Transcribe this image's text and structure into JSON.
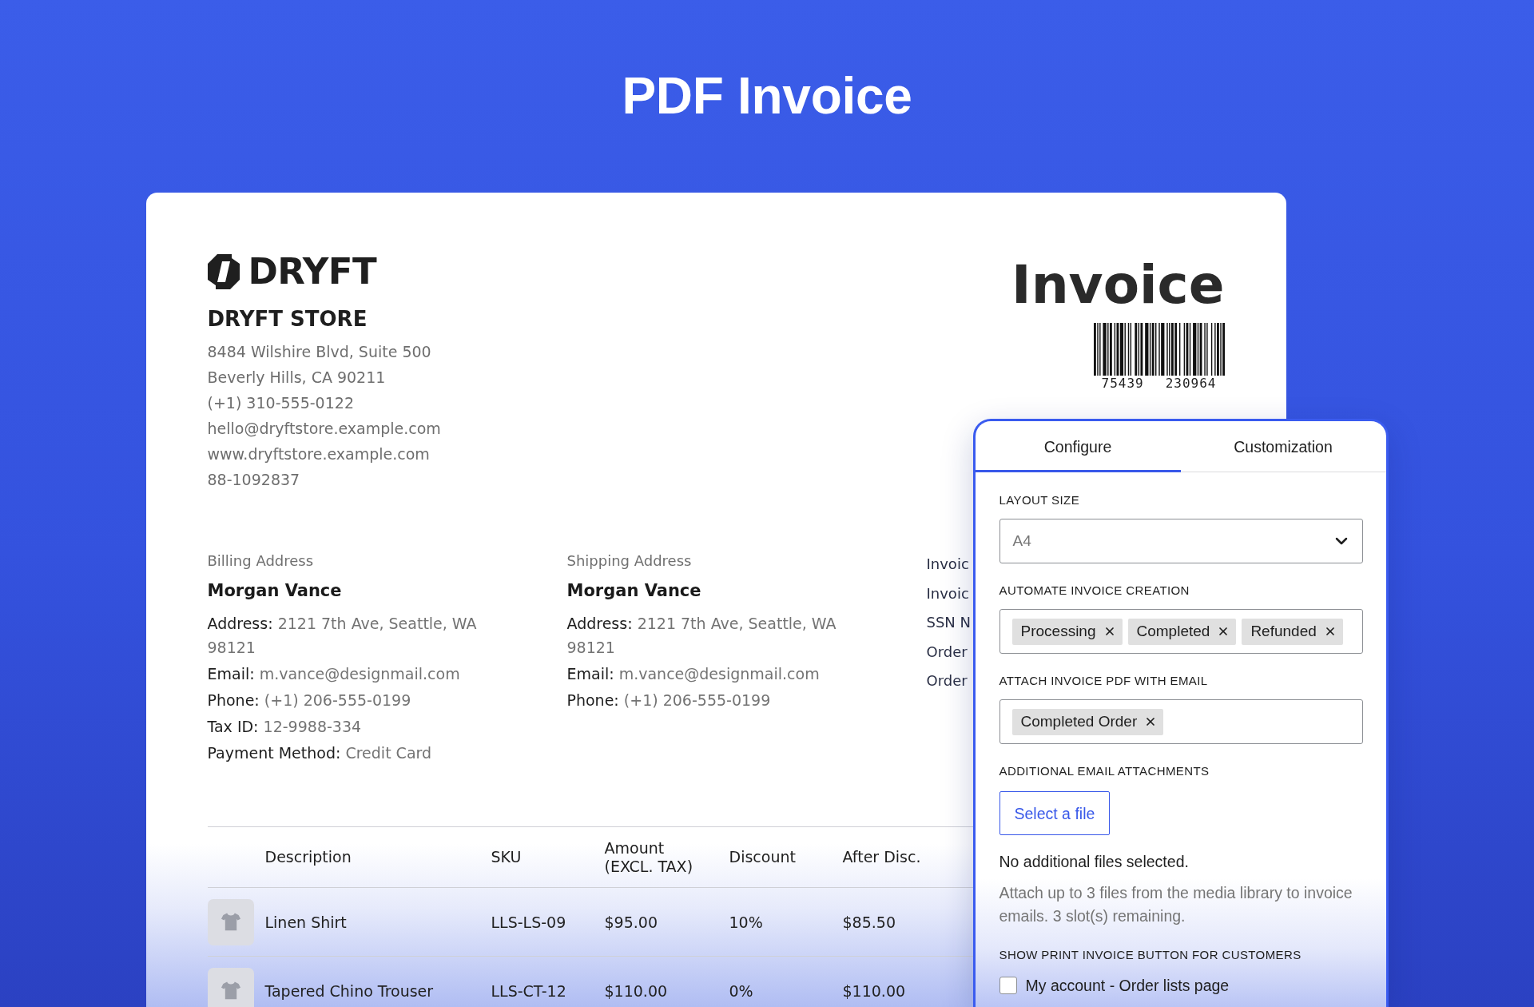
{
  "page_title": "PDF Invoice",
  "invoice": {
    "brand": "DRYFT",
    "store_name": "DRYFT STORE",
    "store_details": [
      "8484 Wilshire Blvd, Suite 500",
      "Beverly Hills, CA 90211",
      "(+1) 310-555-0122",
      "hello@dryftstore.example.com",
      "www.dryftstore.example.com",
      "88-1092837"
    ],
    "title": "Invoice",
    "barcode_digits": [
      "75439",
      "230964"
    ],
    "addresses": [
      {
        "heading": "Billing Address",
        "name": "Morgan Vance",
        "fields": [
          {
            "label": "Address:",
            "value": "2121 7th Ave, Seattle, WA 98121"
          },
          {
            "label": "Email:",
            "value": "m.vance@designmail.com"
          },
          {
            "label": "Phone:",
            "value": "(+1) 206-555-0199"
          },
          {
            "label": "Tax ID:",
            "value": "12-9988-334"
          },
          {
            "label": "Payment Method:",
            "value": "Credit Card"
          }
        ]
      },
      {
        "heading": "Shipping Address",
        "name": "Morgan Vance",
        "fields": [
          {
            "label": "Address:",
            "value": "2121 7th Ave, Seattle, WA 98121"
          },
          {
            "label": "Email:",
            "value": "m.vance@designmail.com"
          },
          {
            "label": "Phone:",
            "value": "(+1) 206-555-0199"
          }
        ]
      }
    ],
    "meta_lines": [
      "Invoic",
      "Invoic",
      "SSN N",
      "Order",
      "Order"
    ],
    "table": {
      "columns": [
        "Description",
        "SKU",
        "Amount (EXCL. TAX)",
        "Discount",
        "After Disc."
      ],
      "rows": [
        [
          "Linen Shirt",
          "LLS-LS-09",
          "$95.00",
          "10%",
          "$85.50"
        ],
        [
          "Tapered Chino Trouser",
          "LLS-CT-12",
          "$110.00",
          "0%",
          "$110.00"
        ]
      ]
    }
  },
  "panel": {
    "tabs": [
      {
        "label": "Configure",
        "selected": true
      },
      {
        "label": "Customization",
        "selected": false
      }
    ],
    "sections": [
      {
        "kind": "select",
        "label": "LAYOUT SIZE",
        "value": "A4"
      },
      {
        "kind": "tags",
        "label": "AUTOMATE INVOICE CREATION",
        "tags": [
          "Processing",
          "Completed",
          "Refunded"
        ]
      },
      {
        "kind": "tags",
        "label": "ATTACH INVOICE PDF WITH EMAIL",
        "tags": [
          "Completed Order"
        ]
      },
      {
        "kind": "file",
        "label": "ADDITIONAL EMAIL ATTACHMENTS",
        "button": "Select a file",
        "status": "No additional files selected.",
        "help": "Attach up to 3 files from the media library to invoice emails. 3 slot(s) remaining."
      },
      {
        "kind": "checkboxes",
        "label": "SHOW PRINT INVOICE BUTTON FOR CUSTOMERS",
        "options": [
          {
            "label": "My account - Order lists page",
            "checked": false
          }
        ]
      }
    ]
  }
}
